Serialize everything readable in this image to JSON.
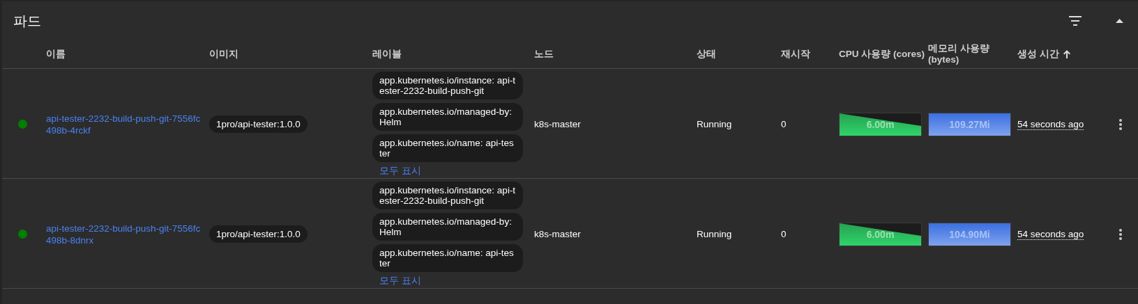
{
  "title": "파드",
  "columns": [
    {
      "label": "이름"
    },
    {
      "label": "이미지"
    },
    {
      "label": "레이블"
    },
    {
      "label": "노드"
    },
    {
      "label": "상태"
    },
    {
      "label": "재시작"
    },
    {
      "label": "CPU 사용량 (cores)"
    },
    {
      "label": "메모리 사용량 (bytes)"
    },
    {
      "label": "생성 시간",
      "sorted": true
    }
  ],
  "rows": [
    {
      "color": "#008000",
      "name": "api-tester-2232-build-push-git-7556fc498b-4rckf",
      "image": "1pro/api-tester:1.0.0",
      "labels": [
        "app.kubernetes.io/instance: api-tester-2232-build-push-git",
        "app.kubernetes.io/managed-by: Helm",
        "app.kubernetes.io/name: api-tester"
      ],
      "show_all": "모두 표시",
      "node": "k8s-master",
      "status": "Running",
      "restarts": "0",
      "cpu": "6.00m",
      "memory": "109.27Mi",
      "created": "54 seconds ago"
    },
    {
      "color": "#008000",
      "name": "api-tester-2232-build-push-git-7556fc498b-8dnrx",
      "image": "1pro/api-tester:1.0.0",
      "labels": [
        "app.kubernetes.io/instance: api-tester-2232-build-push-git",
        "app.kubernetes.io/managed-by: Helm",
        "app.kubernetes.io/name: api-tester"
      ],
      "show_all": "모두 표시",
      "node": "k8s-master",
      "status": "Running",
      "restarts": "0",
      "cpu": "6.00m",
      "memory": "104.90Mi",
      "created": "54 seconds ago"
    }
  ]
}
